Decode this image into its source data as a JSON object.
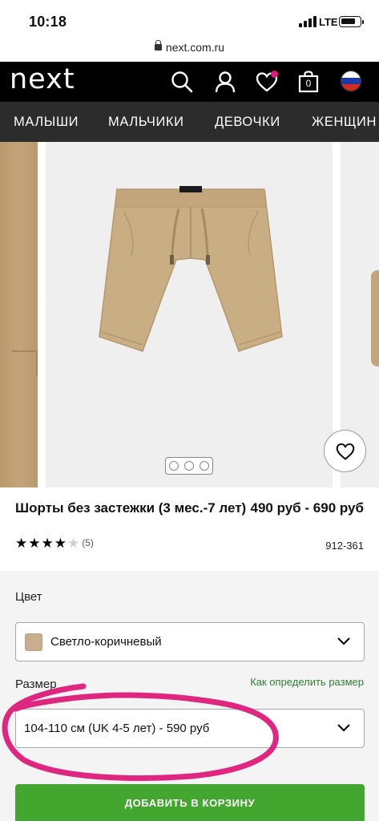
{
  "status_bar": {
    "time": "10:18",
    "network": "LTE",
    "battery_level": 0.8
  },
  "browser": {
    "url": "next.com.ru"
  },
  "header": {
    "logo": "next",
    "bag_count": "0",
    "icons": [
      "search-icon",
      "account-icon",
      "heart-icon",
      "shopping-bag-icon",
      "russia-flag-icon"
    ],
    "wishlist_has_items": true
  },
  "nav": {
    "items": [
      "МАЛЫШИ",
      "МАЛЬЧИКИ",
      "ДЕВОЧКИ",
      "ЖЕНЩИН"
    ]
  },
  "gallery": {
    "image_count": 3,
    "active_index": 0
  },
  "product": {
    "title": "Шорты без застежки (3 мес.-7 лет)",
    "price": "490 руб - 690 руб",
    "item_number": "912-361",
    "rating": 4,
    "rating_max": 5,
    "review_count": "(5)"
  },
  "color_field": {
    "label": "Цвет",
    "value": "Светло-коричневый",
    "swatch_color": "#c6ae8f"
  },
  "size_field": {
    "label": "Размер",
    "guide_link": "Как определить размер",
    "value": "104-110 см (UK 4-5 лет) - 590 руб"
  },
  "add_to_bag": {
    "label": "ДОБАВИТЬ В КОРЗИНУ"
  },
  "colors": {
    "header_bg": "#000000",
    "nav_bg": "#2c2c2c",
    "accent_green": "#42a62f",
    "link_green": "#2e7d32",
    "annotation_pink": "#e0277f"
  }
}
